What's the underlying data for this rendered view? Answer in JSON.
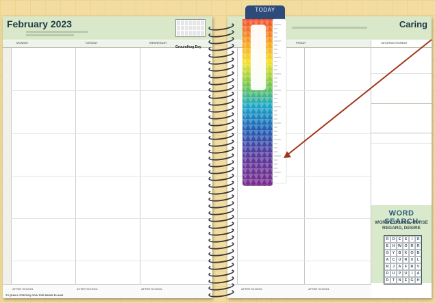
{
  "left_page": {
    "title": "February 2023",
    "days": [
      "MONDAY",
      "TUESDAY",
      "WEDNESDAY"
    ],
    "event": "Groundhog Day",
    "footer_label": "AFTER SCHOOL",
    "bottom_note": "TV (DAILY STATUS) GOA TOE BASIS PLANS"
  },
  "right_page": {
    "title": "Caring",
    "days": [
      "FRIDAY",
      "SATURDAY/SUNDAY"
    ],
    "footer_label": "AFTER SCHOOL"
  },
  "ruler": {
    "label": "TODAY"
  },
  "word_search": {
    "title": "WORD SEARCH",
    "words": "WORRY, GUARD, NURSE REGARD, DESIRE",
    "grid": [
      [
        "R",
        "D",
        "E",
        "S",
        "I",
        "R"
      ],
      [
        "E",
        "H",
        "W",
        "O",
        "R",
        "R"
      ],
      [
        "G",
        "Y",
        "B",
        "K",
        "O",
        "B"
      ],
      [
        "A",
        "C",
        "U",
        "R",
        "X",
        "L"
      ],
      [
        "R",
        "J",
        "A",
        "F",
        "R",
        "V"
      ],
      [
        "D",
        "U",
        "P",
        "U",
        "I",
        "A"
      ],
      [
        "D",
        "T",
        "N",
        "E",
        "G",
        "H"
      ]
    ]
  },
  "colors": {
    "background": "#f2dca0",
    "header_tint": "#d8e8c8",
    "ruler_tab": "#2d4a7a",
    "arrow": "#a0341b"
  }
}
